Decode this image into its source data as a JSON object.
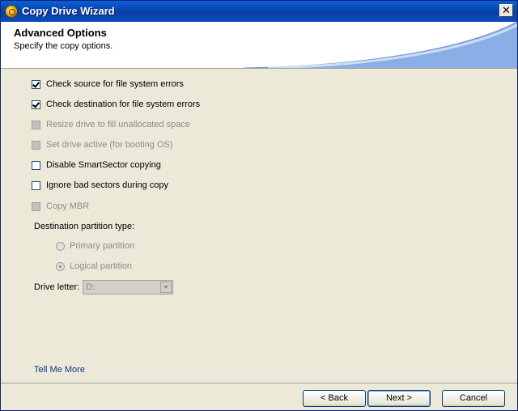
{
  "window": {
    "title": "Copy Drive Wizard"
  },
  "header": {
    "title": "Advanced Options",
    "subtitle": "Specify the copy options."
  },
  "options": [
    {
      "label": "Check source for file system errors",
      "checked": true,
      "enabled": true
    },
    {
      "label": "Check destination for file system errors",
      "checked": true,
      "enabled": true
    },
    {
      "label": "Resize drive to fill unallocated space",
      "checked": false,
      "enabled": false
    },
    {
      "label": "Set drive active (for booting OS)",
      "checked": false,
      "enabled": false
    },
    {
      "label": "Disable SmartSector copying",
      "checked": false,
      "enabled": true
    },
    {
      "label": "Ignore bad sectors during copy",
      "checked": false,
      "enabled": true
    },
    {
      "label": "Copy MBR",
      "checked": false,
      "enabled": false
    }
  ],
  "partition": {
    "label": "Destination partition type:",
    "primary": "Primary partition",
    "logical": "Logical partition",
    "selected": "logical"
  },
  "drive_letter": {
    "label": "Drive letter:",
    "value": "D:"
  },
  "tell_more": "Tell Me More",
  "buttons": {
    "back": "< Back",
    "next": "Next >",
    "cancel": "Cancel"
  },
  "colors": {
    "titlebar": "#0a4fc8",
    "header_swoosh": "#8aaee6",
    "link": "#0b3a8a"
  }
}
